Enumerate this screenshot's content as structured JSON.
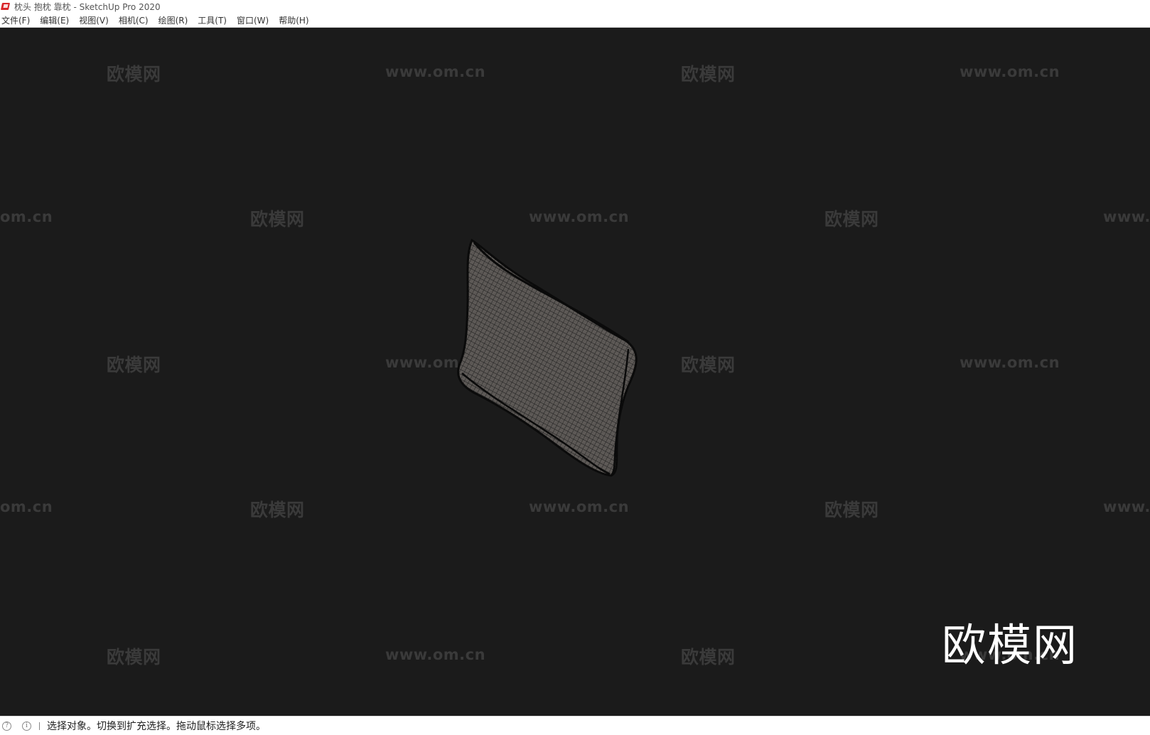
{
  "window": {
    "title": "枕头 抱枕 靠枕 - SketchUp Pro 2020",
    "app_icon": "sketchup-icon"
  },
  "menubar": {
    "items": [
      "文件(F)",
      "编辑(E)",
      "视图(V)",
      "相机(C)",
      "绘图(R)",
      "工具(T)",
      "窗口(W)",
      "帮助(H)"
    ]
  },
  "viewport": {
    "background_color": "#1b1b1b",
    "model": "pillow-wireframe",
    "watermark_logo": "欧模网",
    "watermark_url": "www.om.cn",
    "watermark_partial_url_left": "om.cn",
    "watermark_partial_url_right": "www.",
    "watermark_partial_mid": "www.om.",
    "brand_logo": "欧模网"
  },
  "statusbar": {
    "icons": [
      "geo-location-icon",
      "info-icon"
    ],
    "message": "选择对象。切换到扩充选择。拖动鼠标选择多项。"
  }
}
